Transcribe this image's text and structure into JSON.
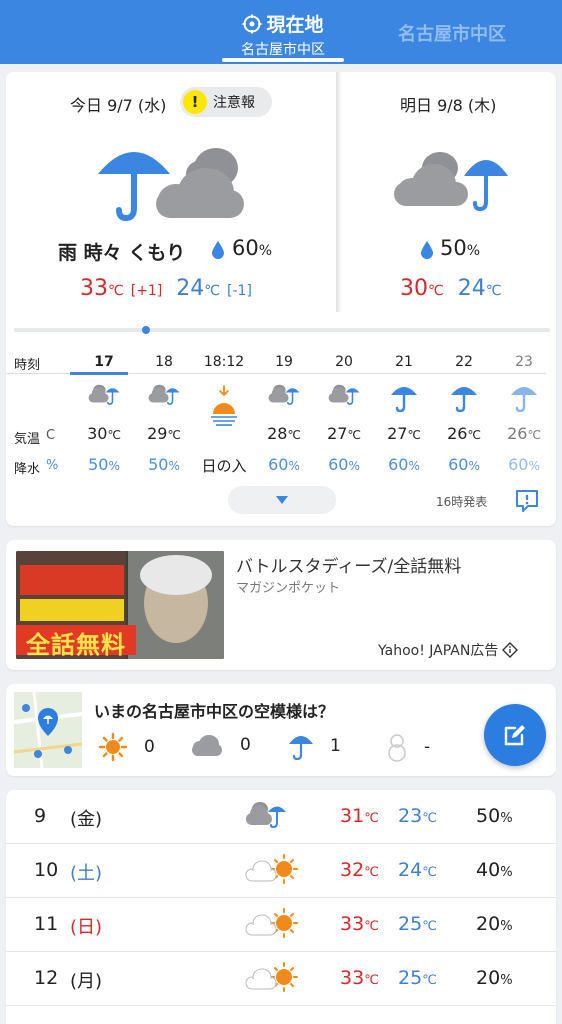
{
  "header": {
    "current_tab_title": "現在地",
    "current_tab_sub": "名古屋市中区",
    "other_tab": "名古屋市中区"
  },
  "today": {
    "title": "今日 9/7 (水)",
    "warning": "注意報",
    "telop": "雨 時々 くもり",
    "pop": "60",
    "pop_unit": "%",
    "high": "33",
    "high_diff": "[+1]",
    "low": "24",
    "low_diff": "[-1]",
    "unit": "℃"
  },
  "tomorrow": {
    "title": "明日 9/8 (木)",
    "pop": "50",
    "pop_unit": "%",
    "high": "30",
    "low": "24",
    "unit": "℃"
  },
  "hourly": {
    "label_time": "時刻",
    "label_temp": "気温",
    "label_rain": "降水",
    "partial_temp": "C",
    "partial_rain": "%",
    "temp_unit": "℃",
    "rain_unit": "%",
    "hours": [
      {
        "time": "17",
        "icon": "cloud-rain-icon",
        "temp": "30",
        "rain": "50"
      },
      {
        "time": "18",
        "icon": "cloud-rain-icon",
        "temp": "29",
        "rain": "50"
      },
      {
        "time": "18:12",
        "icon": "sunset-icon",
        "temp": "",
        "rain": "日の入"
      },
      {
        "time": "19",
        "icon": "cloud-rain-icon",
        "temp": "28",
        "rain": "60"
      },
      {
        "time": "20",
        "icon": "cloud-rain-icon",
        "temp": "27",
        "rain": "60"
      },
      {
        "time": "21",
        "icon": "umbrella-icon",
        "temp": "27",
        "rain": "60"
      },
      {
        "time": "22",
        "icon": "umbrella-icon",
        "temp": "26",
        "rain": "60"
      },
      {
        "time": "23",
        "icon": "umbrella-icon",
        "temp": "26",
        "rain": "60"
      }
    ],
    "issued": "16時発表"
  },
  "ad": {
    "title": "バトルスタディーズ/全話無料",
    "sponsor": "マガジンポケット",
    "label": "Yahoo! JAPAN広告",
    "banner_text": "全話無料"
  },
  "sky": {
    "question": "いまの名古屋市中区の空模様は？",
    "sun_count": "0",
    "cloud_count": "0",
    "rain_count": "1",
    "snow_count": "-"
  },
  "weekly": [
    {
      "day": "9",
      "weekday": "(金)",
      "type": "weekday",
      "icon": "cloud-rain-icon",
      "high": "31",
      "low": "23",
      "pop": "50"
    },
    {
      "day": "10",
      "weekday": "(土)",
      "type": "sat",
      "icon": "cloud-sun-icon",
      "high": "32",
      "low": "24",
      "pop": "40"
    },
    {
      "day": "11",
      "weekday": "(日)",
      "type": "sun",
      "icon": "cloud-sun-icon",
      "high": "33",
      "low": "25",
      "pop": "20"
    },
    {
      "day": "12",
      "weekday": "(月)",
      "type": "weekday",
      "icon": "cloud-sun-icon",
      "high": "33",
      "low": "25",
      "pop": "20"
    }
  ],
  "colors": {
    "header_blue": "#3a86e0",
    "hot_red": "#d62828",
    "cold_blue": "#3f7fcf",
    "umbrella_blue": "#3a86e0"
  }
}
